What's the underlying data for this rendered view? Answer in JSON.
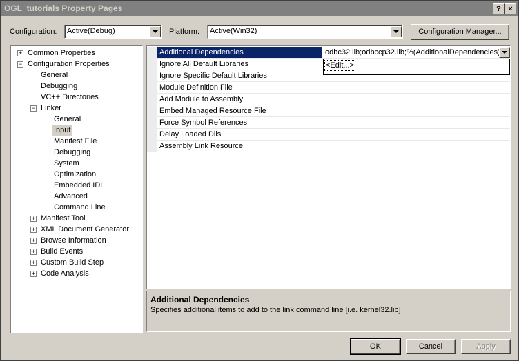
{
  "window": {
    "title": "OGL_tutorials Property Pages",
    "help_glyph": "?",
    "close_glyph": "×"
  },
  "config": {
    "configuration_label": "Configuration:",
    "configuration_value": "Active(Debug)",
    "platform_label": "Platform:",
    "platform_value": "Active(Win32)",
    "manager_button": "Configuration Manager..."
  },
  "tree": {
    "items": [
      {
        "label": "Common Properties",
        "expander": "+"
      },
      {
        "label": "Configuration Properties",
        "expander": "−"
      },
      {
        "label": "General"
      },
      {
        "label": "Debugging"
      },
      {
        "label": "VC++ Directories"
      },
      {
        "label": "Linker",
        "expander": "−"
      },
      {
        "label": "General"
      },
      {
        "label": "Input",
        "selected": true
      },
      {
        "label": "Manifest File"
      },
      {
        "label": "Debugging"
      },
      {
        "label": "System"
      },
      {
        "label": "Optimization"
      },
      {
        "label": "Embedded IDL"
      },
      {
        "label": "Advanced"
      },
      {
        "label": "Command Line"
      },
      {
        "label": "Manifest Tool",
        "expander": "+"
      },
      {
        "label": "XML Document Generator",
        "expander": "+"
      },
      {
        "label": "Browse Information",
        "expander": "+"
      },
      {
        "label": "Build Events",
        "expander": "+"
      },
      {
        "label": "Custom Build Step",
        "expander": "+"
      },
      {
        "label": "Code Analysis",
        "expander": "+"
      }
    ]
  },
  "grid": {
    "rows": [
      {
        "name": "Additional Dependencies",
        "value": "odbc32.lib;odbccp32.lib;%(AdditionalDependencies)",
        "selected": true
      },
      {
        "name": "Ignore All Default Libraries",
        "value": ""
      },
      {
        "name": "Ignore Specific Default Libraries",
        "value": ""
      },
      {
        "name": "Module Definition File",
        "value": ""
      },
      {
        "name": "Add Module to Assembly",
        "value": ""
      },
      {
        "name": "Embed Managed Resource File",
        "value": ""
      },
      {
        "name": "Force Symbol References",
        "value": ""
      },
      {
        "name": "Delay Loaded Dlls",
        "value": ""
      },
      {
        "name": "Assembly Link Resource",
        "value": ""
      }
    ],
    "dropdown_item": "<Edit...>"
  },
  "description": {
    "title": "Additional Dependencies",
    "text": "Specifies additional items to add to the link command line [i.e. kernel32.lib]"
  },
  "buttons": {
    "ok": "OK",
    "cancel": "Cancel",
    "apply": "Apply"
  },
  "colors": {
    "face": "#d4d0c8",
    "selection": "#0a246a",
    "titlebar_inactive": "#808080"
  }
}
